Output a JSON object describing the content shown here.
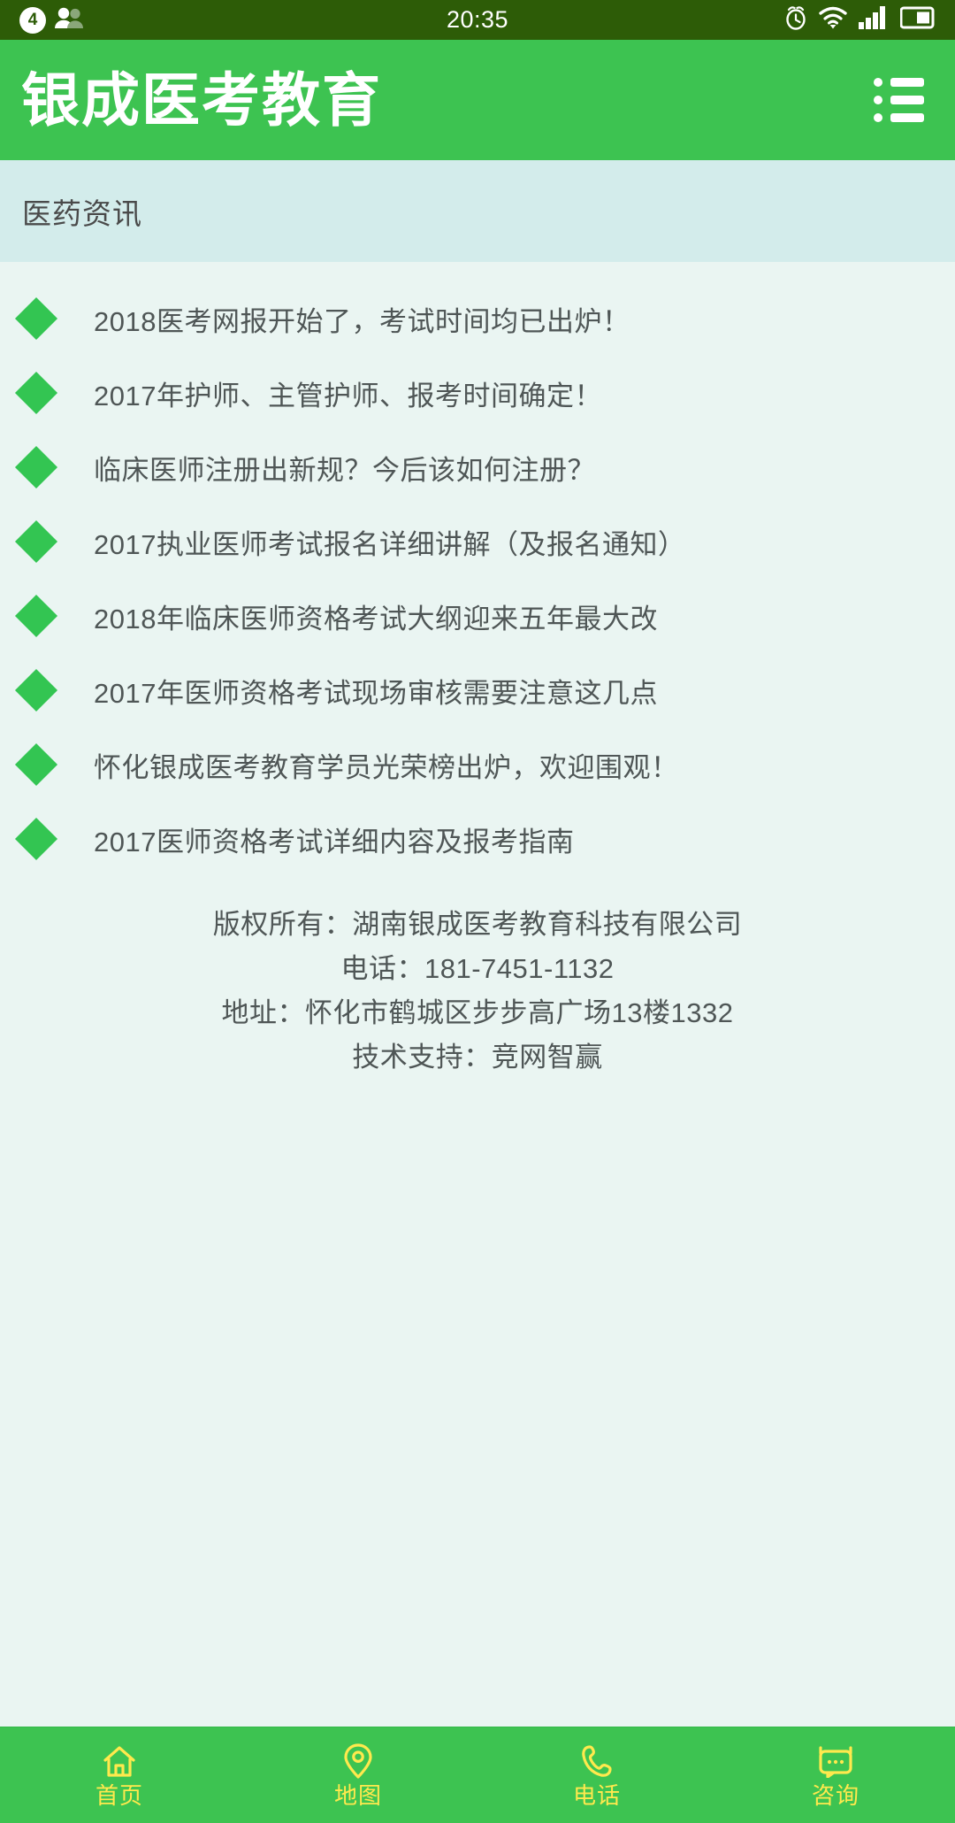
{
  "statusbar": {
    "badge_count": "4",
    "time": "20:35",
    "icons": [
      "people-icon",
      "alarm-icon",
      "wifi-icon",
      "signal-icon",
      "battery-icon"
    ]
  },
  "header": {
    "title": "银成医考教育",
    "menu_icon": "list-menu-icon",
    "bg_color": "#3dc351"
  },
  "section": {
    "title": "医药资讯",
    "bg_color": "#d3eceb"
  },
  "news": {
    "bullet_color": "#33c552",
    "items": [
      {
        "title": "2018医考网报开始了，考试时间均已出炉！"
      },
      {
        "title": "2017年护师、主管护师、报考时间确定！"
      },
      {
        "title": "临床医师注册出新规？今后该如何注册？"
      },
      {
        "title": "2017执业医师考试报名详细讲解（及报名通知）"
      },
      {
        "title": "2018年临床医师资格考试大纲迎来五年最大改"
      },
      {
        "title": "2017年医师资格考试现场审核需要注意这几点"
      },
      {
        "title": "怀化银成医考教育学员光荣榜出炉，欢迎围观！"
      },
      {
        "title": "2017医师资格考试详细内容及报考指南"
      }
    ]
  },
  "footer": {
    "lines": [
      "版权所有：湖南银成医考教育科技有限公司",
      "电话：181-7451-1132",
      "地址：怀化市鹤城区步步高广场13楼1332",
      "技术支持：竞网智赢"
    ]
  },
  "bottomnav": {
    "accent_color": "#ffe94d",
    "bg_color": "#3dc351",
    "items": [
      {
        "label": "首页",
        "icon": "home-icon"
      },
      {
        "label": "地图",
        "icon": "map-pin-icon"
      },
      {
        "label": "电话",
        "icon": "phone-icon"
      },
      {
        "label": "咨询",
        "icon": "chat-icon"
      }
    ]
  }
}
